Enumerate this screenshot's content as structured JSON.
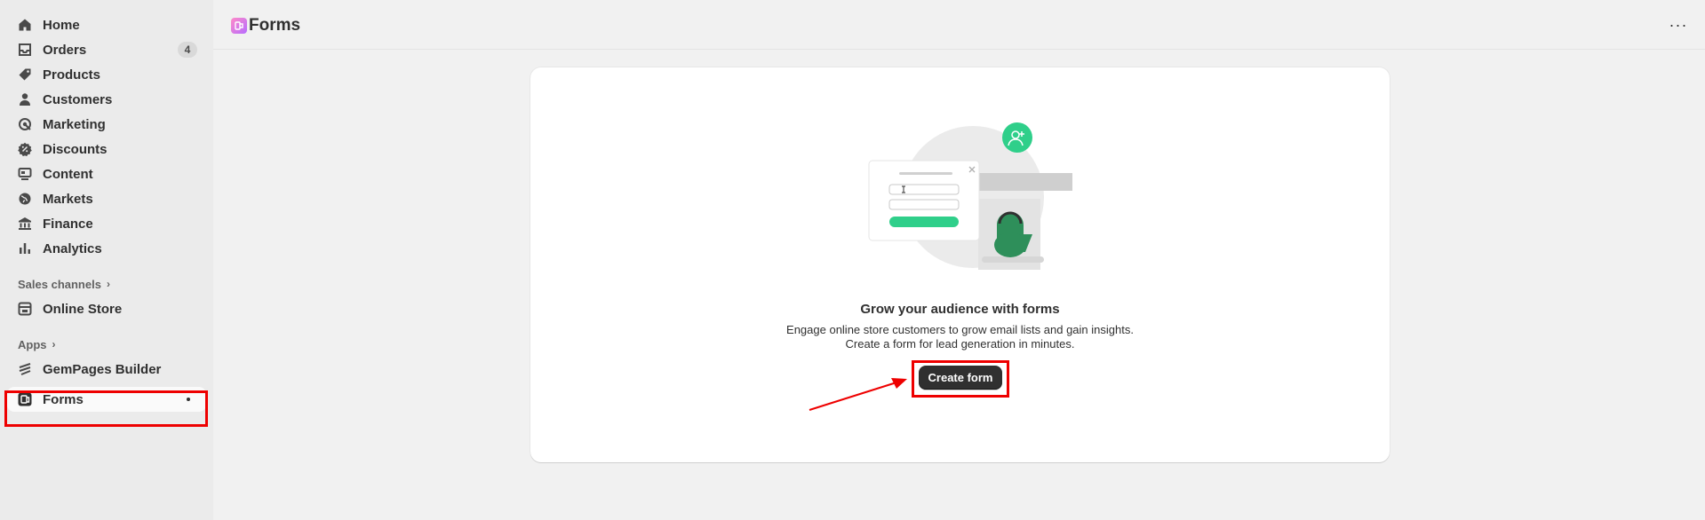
{
  "sidebar": {
    "items": [
      {
        "label": "Home",
        "icon": "home-icon"
      },
      {
        "label": "Orders",
        "icon": "inbox-icon",
        "badge": "4"
      },
      {
        "label": "Products",
        "icon": "tag-icon"
      },
      {
        "label": "Customers",
        "icon": "person-icon"
      },
      {
        "label": "Marketing",
        "icon": "target-icon"
      },
      {
        "label": "Discounts",
        "icon": "discount-icon"
      },
      {
        "label": "Content",
        "icon": "content-icon"
      },
      {
        "label": "Markets",
        "icon": "globe-icon"
      },
      {
        "label": "Finance",
        "icon": "bank-icon"
      },
      {
        "label": "Analytics",
        "icon": "bar-chart-icon"
      }
    ],
    "sales_channels_label": "Sales channels",
    "online_store_label": "Online Store",
    "apps_label": "Apps",
    "gempages_label": "GemPages Builder",
    "forms_label": "Forms"
  },
  "header": {
    "title": "Forms",
    "more_label": "···"
  },
  "card": {
    "heading": "Grow your audience with forms",
    "line1": "Engage online store customers to grow email lists and gain insights.",
    "line2": "Create a form for lead generation in minutes.",
    "button_label": "Create form"
  },
  "colors": {
    "highlight": "#ee0000",
    "accent_green": "#2fcf8a",
    "button_bg": "#303030"
  }
}
